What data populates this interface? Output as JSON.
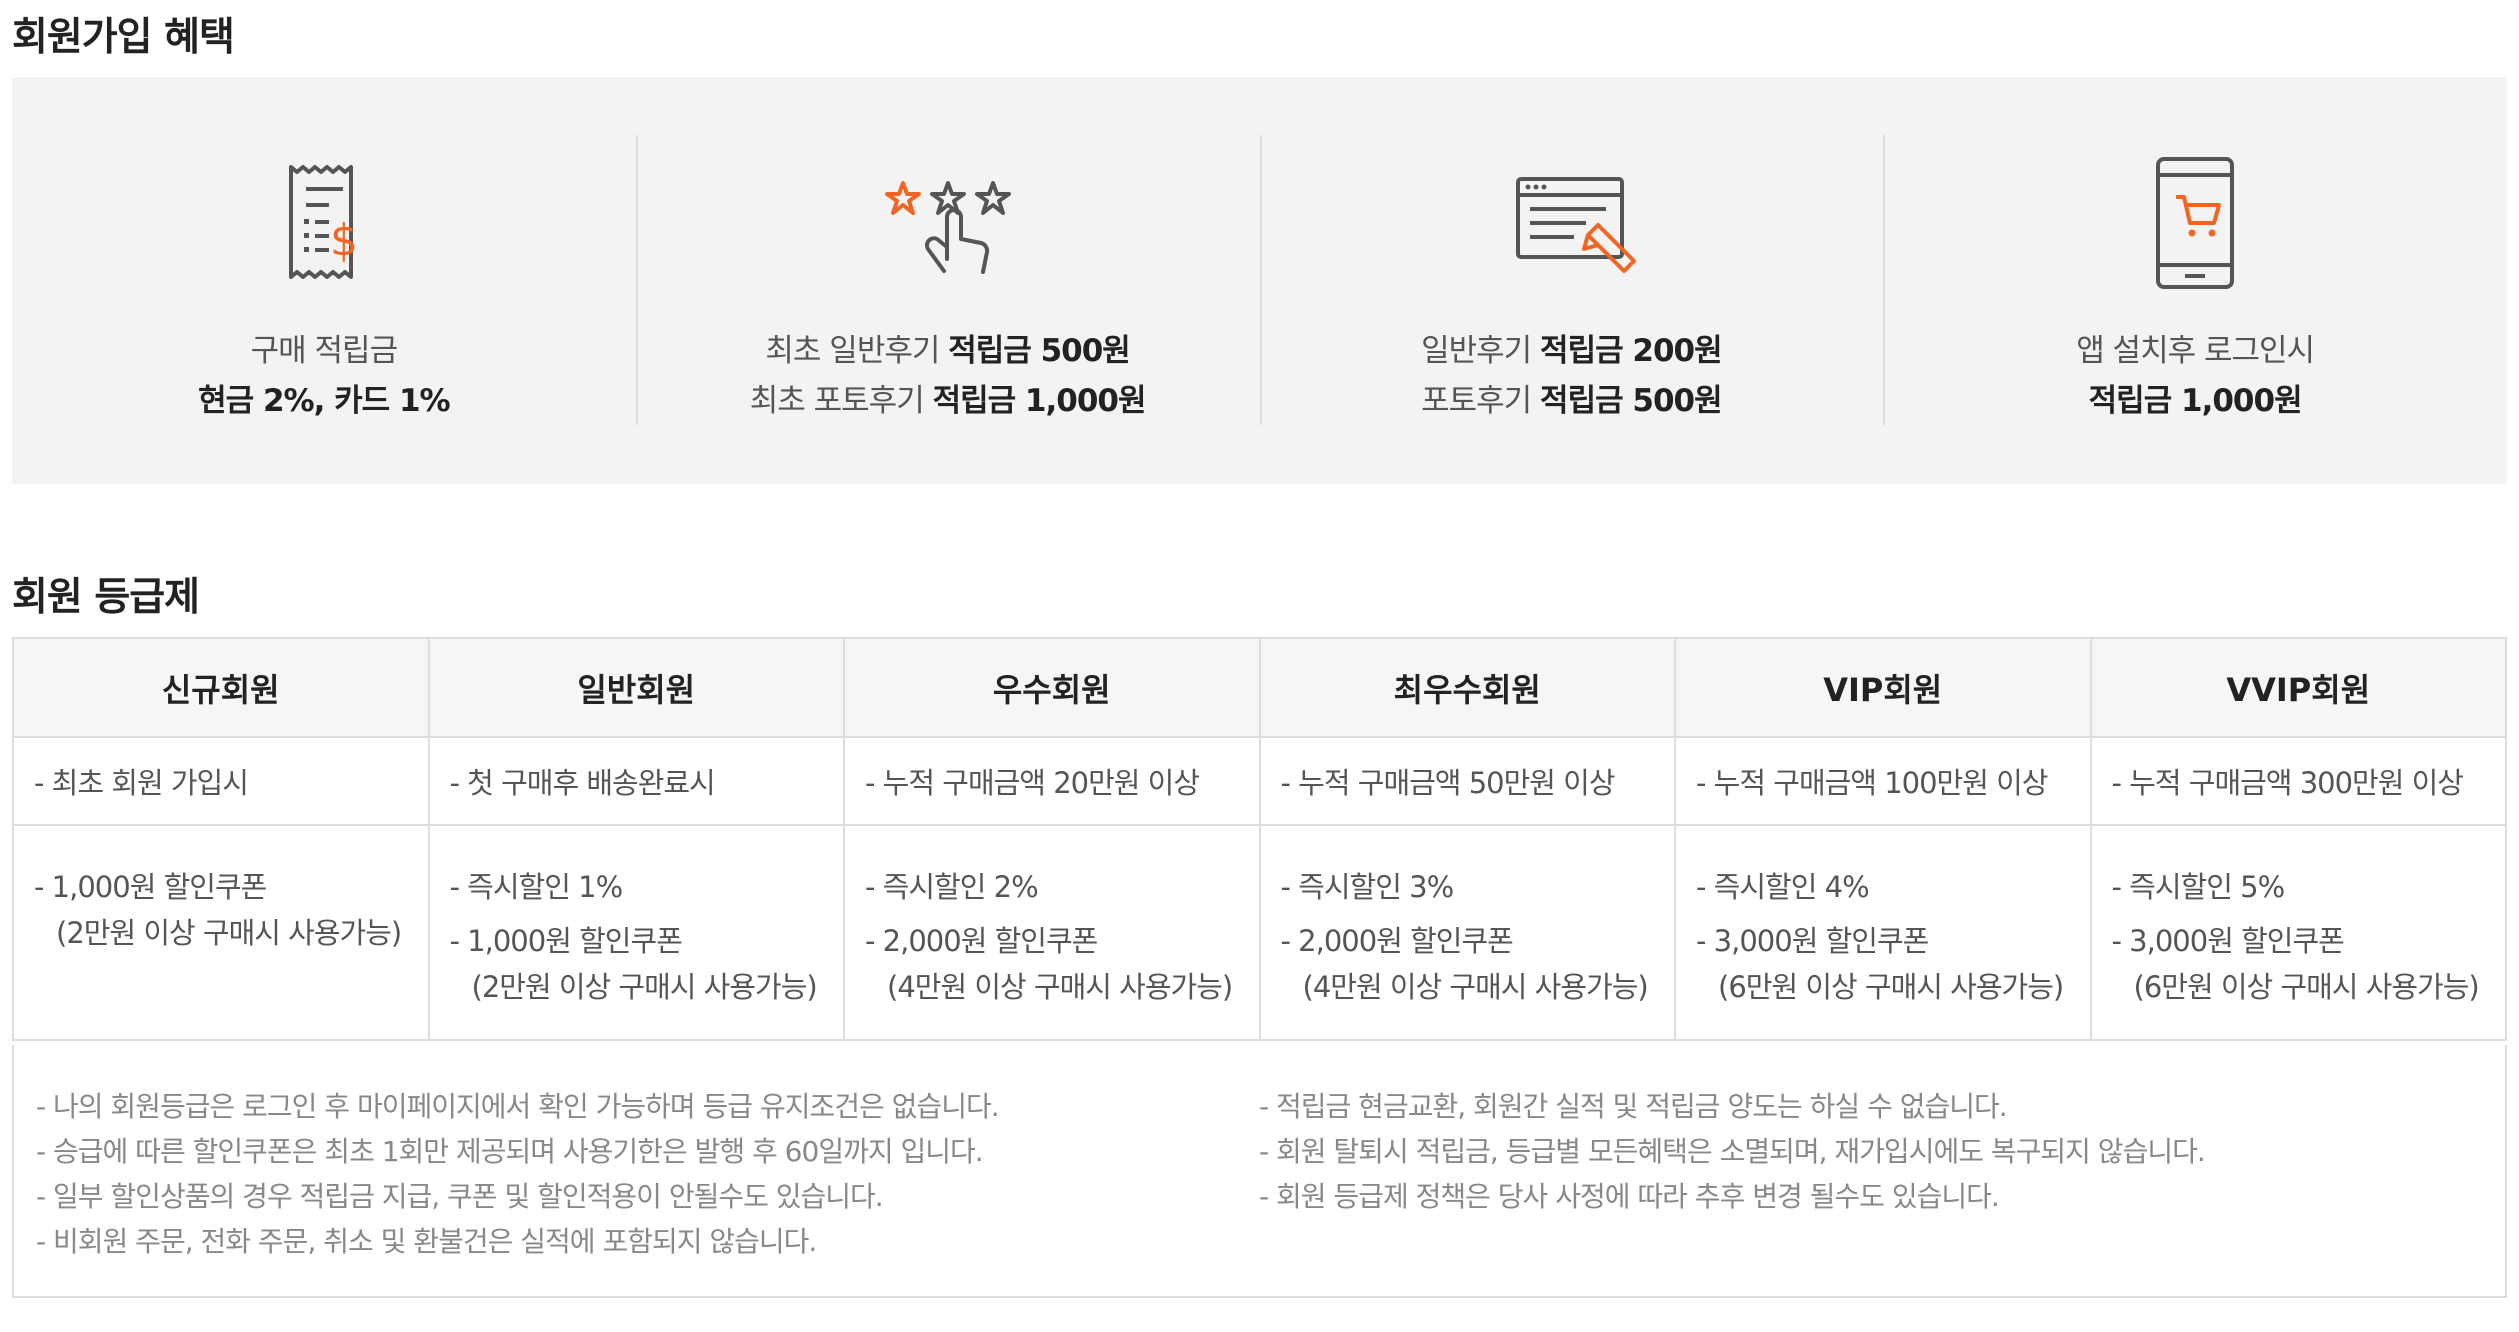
{
  "benefits_title": "회원가입 혜택",
  "benefits": [
    {
      "icon": "receipt-icon",
      "line1": "구매 적립금",
      "line2_bold": "현금 2%, 카드 1%",
      "line2_pre": "",
      "line1_pre": "",
      "line1_bold": ""
    },
    {
      "icon": "star-rating-icon",
      "line1_pre": "최초 일반후기 ",
      "line1_bold": "적립금 500원",
      "line2_pre": "최초 포토후기 ",
      "line2_bold": "적립금 1,000원"
    },
    {
      "icon": "review-write-icon",
      "line1_pre": "일반후기 ",
      "line1_bold": "적립금 200원",
      "line2_pre": "포토후기 ",
      "line2_bold": "적립금 500원"
    },
    {
      "icon": "mobile-cart-icon",
      "line1": "앱 설치후 로그인시",
      "line2_bold": "적립금 1,000원",
      "line2_pre": "",
      "line1_pre": "",
      "line1_bold": ""
    }
  ],
  "grade_title": "회원 등급제",
  "grades": [
    {
      "name": "신규회원",
      "condition": "- 최초 회원 가입시",
      "benefits": [
        {
          "main": "- 1,000원 할인쿠폰",
          "sub": "(2만원 이상 구매시 사용가능)"
        }
      ]
    },
    {
      "name": "일반회원",
      "condition": "- 첫 구매후 배송완료시",
      "benefits": [
        {
          "main": "- 즉시할인 1%",
          "sub": ""
        },
        {
          "main": "- 1,000원 할인쿠폰",
          "sub": "(2만원 이상 구매시 사용가능)"
        }
      ]
    },
    {
      "name": "우수회원",
      "condition": "- 누적 구매금액 20만원 이상",
      "benefits": [
        {
          "main": "- 즉시할인 2%",
          "sub": ""
        },
        {
          "main": "- 2,000원 할인쿠폰",
          "sub": "(4만원 이상 구매시 사용가능)"
        }
      ]
    },
    {
      "name": "최우수회원",
      "condition": "- 누적 구매금액 50만원 이상",
      "benefits": [
        {
          "main": "- 즉시할인 3%",
          "sub": ""
        },
        {
          "main": "- 2,000원 할인쿠폰",
          "sub": "(4만원 이상 구매시 사용가능)"
        }
      ]
    },
    {
      "name": "VIP회원",
      "condition": "- 누적 구매금액 100만원 이상",
      "benefits": [
        {
          "main": "- 즉시할인 4%",
          "sub": ""
        },
        {
          "main": "- 3,000원 할인쿠폰",
          "sub": "(6만원 이상 구매시 사용가능)"
        }
      ]
    },
    {
      "name": "VVIP회원",
      "condition": "- 누적 구매금액 300만원 이상",
      "benefits": [
        {
          "main": "- 즉시할인 5%",
          "sub": ""
        },
        {
          "main": "- 3,000원 할인쿠폰",
          "sub": "(6만원 이상 구매시 사용가능)"
        }
      ]
    }
  ],
  "notes_left": [
    "- 나의 회원등급은 로그인 후 마이페이지에서 확인 가능하며 등급 유지조건은 없습니다.",
    "- 승급에 따른 할인쿠폰은 최초 1회만 제공되며 사용기한은 발행 후 60일까지 입니다.",
    "- 일부 할인상품의 경우 적립금 지급, 쿠폰 및 할인적용이 안될수도 있습니다.",
    "- 비회원 주문, 전화 주문, 취소 및 환불건은 실적에 포함되지 않습니다."
  ],
  "notes_right": [
    "- 적립금 현금교환, 회원간 실적 및 적립금 양도는 하실 수 없습니다.",
    "- 회원 탈퇴시 적립금, 등급별 모든혜택은 소멸되며, 재가입시에도 복구되지 않습니다.",
    "- 회원 등급제 정책은 당사 사정에 따라 추후 변경 될수도 있습니다."
  ],
  "colors": {
    "accent": "#f26522",
    "icon_stroke": "#555555",
    "box_bg": "#f3f3f3",
    "border": "#dcdcdc"
  }
}
